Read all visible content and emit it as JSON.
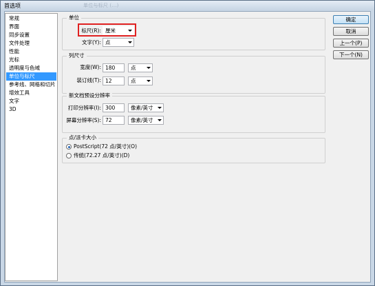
{
  "window": {
    "title": "首选项",
    "blurred_title": "单位与标尺 (...)"
  },
  "sidebar": {
    "items": [
      {
        "label": "常规"
      },
      {
        "label": "界面"
      },
      {
        "label": "同步设置"
      },
      {
        "label": "文件处理"
      },
      {
        "label": "性能"
      },
      {
        "label": "光标"
      },
      {
        "label": "透明度与色域"
      },
      {
        "label": "单位与标尺",
        "selected": true
      },
      {
        "label": "参考线、网格和切片"
      },
      {
        "label": "增效工具"
      },
      {
        "label": "文字"
      },
      {
        "label": "3D"
      }
    ]
  },
  "units": {
    "title": "单位",
    "ruler_label": "标尺(R):",
    "ruler_value": "厘米",
    "type_label": "文字(Y):",
    "type_value": "点"
  },
  "column_size": {
    "title": "列尺寸",
    "width_label": "宽度(W):",
    "width_value": "180",
    "width_unit": "点",
    "gutter_label": "装订线(T):",
    "gutter_value": "12",
    "gutter_unit": "点"
  },
  "new_doc": {
    "title": "新文档预设分辨率",
    "print_label": "打印分辨率(I):",
    "print_value": "300",
    "print_unit": "像素/英寸",
    "screen_label": "屏幕分辨率(S):",
    "screen_value": "72",
    "screen_unit": "像素/英寸"
  },
  "point_size": {
    "title": "点/派卡大小",
    "postscript_label": "PostScript(72 点/英寸)(O)",
    "traditional_label": "传统(72.27 点/英寸)(D)"
  },
  "buttons": {
    "ok": "确定",
    "cancel": "取消",
    "prev": "上一个(P)",
    "next": "下一个(N)"
  }
}
